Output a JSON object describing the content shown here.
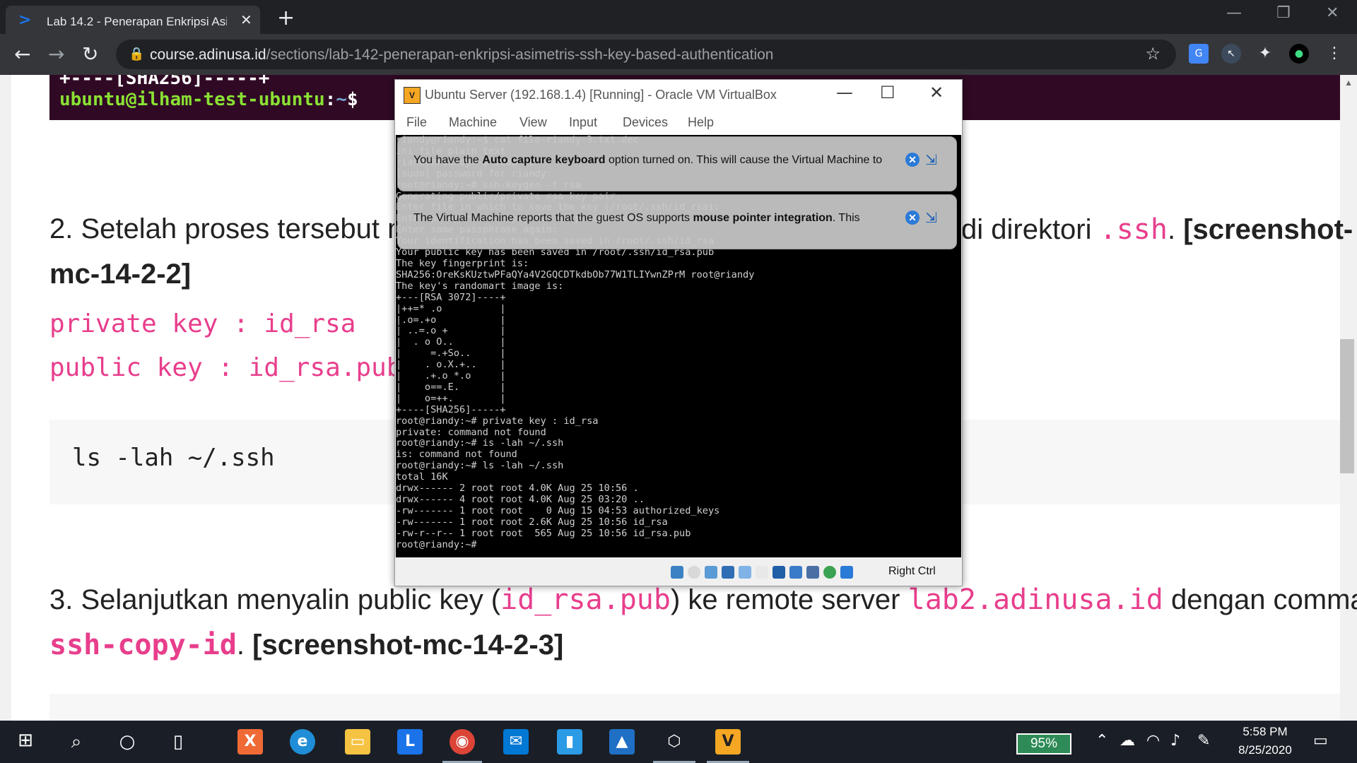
{
  "browser": {
    "tab_title": "Lab 14.2 - Penerapan Enkripsi Asi",
    "tab_close": "✕",
    "new_tab": "+",
    "url_host": "course.adinusa.id",
    "url_path": "/sections/lab-142-penerapan-enkripsi-asimetris-ssh-key-based-authentication",
    "icons": [
      "back-arrow-icon",
      "forward-arrow-icon",
      "reload-icon",
      "lock-icon",
      "star-icon",
      "translate-icon",
      "cursor-extension-icon",
      "extensions-puzzle-icon",
      "profile-icon",
      "menu-dots-icon"
    ]
  },
  "page": {
    "terminal_sha_line": "+----[SHA256]-----+",
    "terminal_prompt_user": "ubuntu@ilham-test-ubuntu",
    "terminal_prompt_sep": ":",
    "terminal_prompt_path": "~",
    "terminal_prompt_dollar": "$",
    "step2_prefix": "2. Setelah proses tersebut m",
    "step2_suffix_text": "di direktori ",
    "step2_code": ".ssh",
    "step2_dot": ". ",
    "step2_shot_a": "[screenshot-",
    "step2_shot_b": "mc-14-2-2]",
    "private_key_line": "private key : id_rsa",
    "public_key_line": "public key : id_rsa.pub",
    "code_command": "ls -lah ~/.ssh",
    "step3_a": "3. Selanjutkan menyalin public key (",
    "step3_code1": "id_rsa.pub",
    "step3_b": ") ke remote server ",
    "step3_code2": "lab2.adinusa.id",
    "step3_c": " dengan command",
    "step3_code3": "ssh-copy-id",
    "step3_d": ". ",
    "step3_shot": "[screenshot-mc-14-2-3]"
  },
  "vbox": {
    "title": "Ubuntu Server (192.168.1.4) [Running] - Oracle VM VirtualBox",
    "menu": [
      "File",
      "Machine",
      "View",
      "Input",
      "Devices",
      "Help"
    ],
    "banner1": {
      "pre": "You have the ",
      "bold": "Auto capture keyboard",
      "post": " option turned on. This will cause the Virtual Machine to"
    },
    "banner2": {
      "pre": "The Virtual Machine reports that the guest OS supports ",
      "bold": "mouse pointer integration",
      "post": ". This"
    },
    "terminal_lines": [
      "riandy@riandy:~$ cat file-riandy-3.txt.dec",
      "ini file plain text",
      "riandy@riandy:~$ sudo su",
      "[sudo] password for riandy:",
      "root@riandy:~# ssh-keygen -t rsa",
      "Generating public/private rsa key pair.",
      "Enter file in which to save the key (/root/.ssh/id_rsa):",
      "Enter passphrase (empty for no passphrase):",
      "Enter same passphrase again:",
      "Your identification has been saved in /root/.ssh/id_rsa",
      "Your public key has been saved in /root/.ssh/id_rsa.pub",
      "The key fingerprint is:",
      "SHA256:OreKsKUztwPFaQYa4V2GQCDTkdbOb77W1TLIYwnZPrM root@riandy",
      "The key's randomart image is:",
      "+---[RSA 3072]----+",
      "|++=* .o          |",
      "|.o=.+o           |",
      "| ..=.o +         |",
      "|  . o O..        |",
      "|     =.+So..     |",
      "|    . o.X.+..    |",
      "|    .+.o *.o     |",
      "|    o==.E.       |",
      "|    o=++.        |",
      "+----[SHA256]-----+",
      "root@riandy:~# private key : id_rsa",
      "private: command not found",
      "root@riandy:~# is -lah ~/.ssh",
      "is: command not found",
      "root@riandy:~# ls -lah ~/.ssh",
      "total 16K",
      "drwx------ 2 root root 4.0K Aug 25 10:56 .",
      "drwx------ 4 root root 4.0K Aug 25 03:20 ..",
      "-rw------- 1 root root    0 Aug 15 04:53 authorized_keys",
      "-rw------- 1 root root 2.6K Aug 25 10:56 id_rsa",
      "-rw-r--r-- 1 root root  565 Aug 25 10:56 id_rsa.pub",
      "root@riandy:~#"
    ],
    "host_key": "Right Ctrl"
  },
  "taskbar": {
    "battery": "95%",
    "time": "5:58 PM",
    "date": "8/25/2020"
  }
}
